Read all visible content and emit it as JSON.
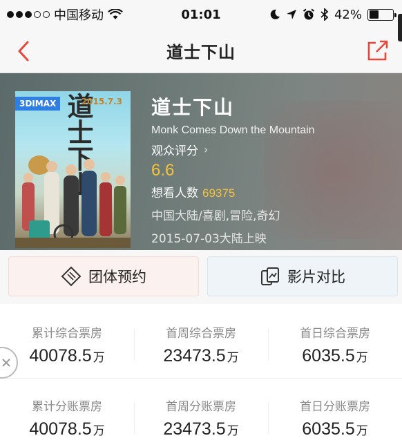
{
  "status_bar": {
    "carrier": "中国移动",
    "time": "01:01",
    "battery_percent": "42%",
    "battery_level": 0.42,
    "icons": [
      "signal-icon",
      "wifi-icon",
      "moon-icon",
      "location-icon",
      "alarm-icon",
      "bluetooth-icon",
      "battery-icon"
    ]
  },
  "nav": {
    "title": "道士下山",
    "back_icon": "back-chevron-icon",
    "share_icon": "share-icon"
  },
  "movie": {
    "poster_tag": "3DIMAX",
    "poster_title": "道士下山",
    "poster_date": "2015.7.3",
    "title_cn": "道士下山",
    "title_en": "Monk Comes Down the Mountain",
    "rating_label": "观众评分",
    "rating_chevron": "›",
    "score": "6.6",
    "want_label": "想看人数",
    "want_count": "69375",
    "genre": "中国大陆/喜剧,冒险,奇幻",
    "release": "2015-07-03大陆上映",
    "accent_color": "#f5c33b"
  },
  "actions": {
    "group_booking": "团体预约",
    "compare": "影片对比"
  },
  "stats": {
    "rows": [
      [
        {
          "label": "累计综合票房",
          "value": "40078.5",
          "unit": "万"
        },
        {
          "label": "首周综合票房",
          "value": "23473.5",
          "unit": "万"
        },
        {
          "label": "首日综合票房",
          "value": "6035.5",
          "unit": "万"
        }
      ],
      [
        {
          "label": "累计分账票房",
          "value": "40078.5",
          "unit": "万"
        },
        {
          "label": "首周分账票房",
          "value": "23473.5",
          "unit": "万"
        },
        {
          "label": "首日分账票房",
          "value": "6035.5",
          "unit": "万"
        }
      ]
    ]
  },
  "colors": {
    "brand_red": "#e8483a",
    "score_yellow": "#f5c33b"
  }
}
